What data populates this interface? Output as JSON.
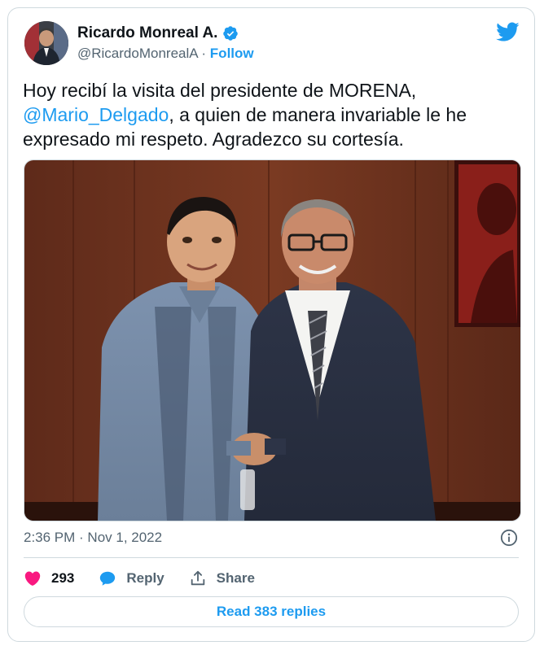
{
  "author": {
    "name": "Ricardo Monreal A.",
    "handle": "@RicardoMonrealA",
    "separator": "·",
    "follow_label": "Follow"
  },
  "tweet": {
    "text_part1": "Hoy recibí la visita del presidente de MORENA,",
    "mention": "@Mario_Delgado",
    "text_part2": ", a quien de manera invariable le he expresado mi respeto. Agradezco su cortesía."
  },
  "meta": {
    "timestamp": "2:36 PM · Nov 1, 2022"
  },
  "actions": {
    "likes": "293",
    "reply_label": "Reply",
    "share_label": "Share"
  },
  "read_replies_label": "Read 383 replies",
  "colors": {
    "accent": "#1d9bf0",
    "heart": "#f91880",
    "muted": "#536471",
    "border": "#cfd9de"
  }
}
